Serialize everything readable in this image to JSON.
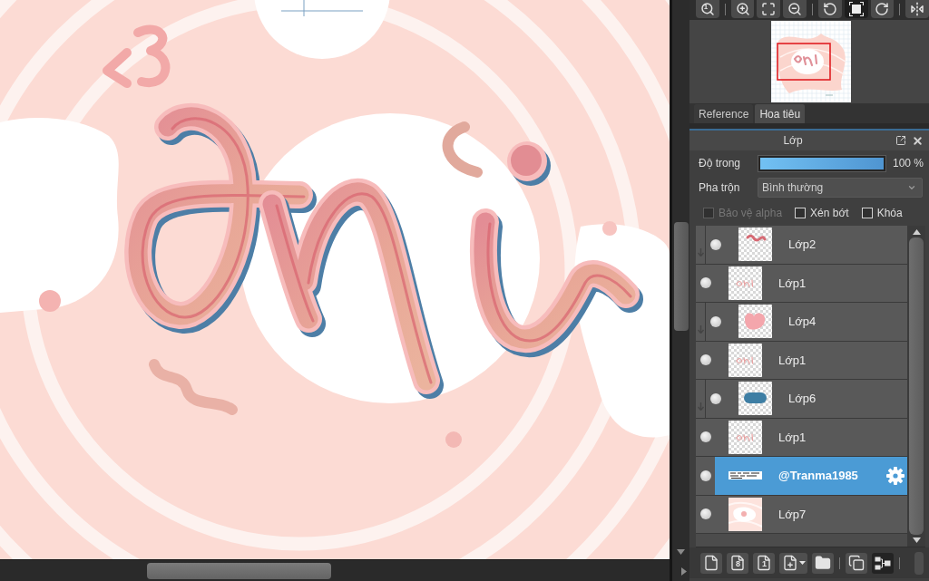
{
  "view_toolbar": [
    {
      "label": "1",
      "selected": false
    },
    {
      "selected": false
    },
    {
      "selected": false
    },
    {
      "selected": false
    },
    {
      "selected": false
    },
    {
      "selected": true
    },
    {
      "selected": false
    },
    {
      "selected": false
    }
  ],
  "navigator_tabs": [
    {
      "label": "Reference",
      "selected": false
    },
    {
      "label": "Hoa tiêu",
      "selected": true
    }
  ],
  "layer_panel": {
    "title": "Lớp",
    "opacity": {
      "label": "Độ trong",
      "level": 1,
      "reading": "100 %"
    },
    "blend_mode": {
      "label": "Pha trộn",
      "value": "Bình thường"
    },
    "options": [
      {
        "label": "Bảo vệ alpha",
        "checked": false,
        "disabled": true
      },
      {
        "label": "Xén bớt",
        "checked": false,
        "disabled": false
      },
      {
        "label": "Khóa",
        "checked": false,
        "disabled": false
      }
    ],
    "layers": [
      {
        "name": "Lớp2",
        "clipped": true,
        "visible": true,
        "selected": false
      },
      {
        "name": "Lớp1",
        "clipped": false,
        "visible": true,
        "selected": false
      },
      {
        "name": "Lớp4",
        "clipped": true,
        "visible": true,
        "selected": false
      },
      {
        "name": "Lớp1",
        "clipped": false,
        "visible": true,
        "selected": false
      },
      {
        "name": "Lớp6",
        "clipped": true,
        "visible": true,
        "selected": false
      },
      {
        "name": "Lớp1",
        "clipped": false,
        "visible": true,
        "selected": false
      },
      {
        "name": "@Tranma1985",
        "clipped": false,
        "visible": true,
        "selected": true
      },
      {
        "name": "Lớp7",
        "clipped": false,
        "visible": true,
        "selected": false
      }
    ]
  },
  "layer_toolbar": [
    {
      "selected": false
    },
    {
      "label": "8",
      "selected": false
    },
    {
      "label": "1",
      "selected": false
    },
    {
      "selected": false
    },
    {
      "selected": false
    },
    {
      "selected": false
    },
    {
      "selected": true
    }
  ]
}
